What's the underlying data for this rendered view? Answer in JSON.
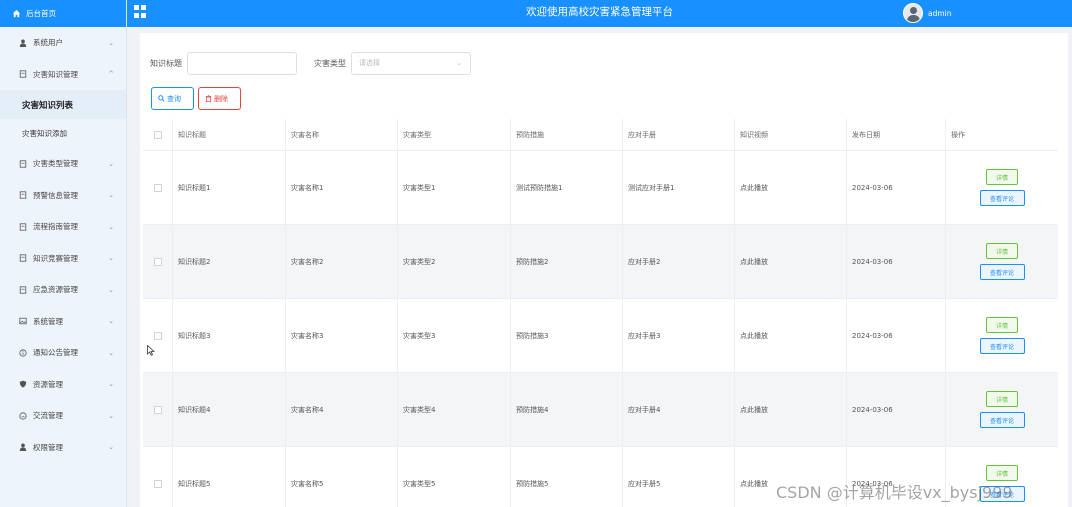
{
  "header": {
    "title": "欢迎使用高校灾害紧急管理平台",
    "user": "admin"
  },
  "sidebar": {
    "home": "后台首页",
    "items": [
      {
        "label": "系统用户",
        "icon": "user-icon",
        "expanded": false
      },
      {
        "label": "灾害知识管理",
        "icon": "doc-icon",
        "expanded": true,
        "children": [
          {
            "label": "灾害知识列表",
            "active": true
          },
          {
            "label": "灾害知识添加",
            "active": false
          }
        ]
      },
      {
        "label": "灾害类型管理",
        "icon": "doc-icon",
        "expanded": false
      },
      {
        "label": "预警信息管理",
        "icon": "doc-icon",
        "expanded": false
      },
      {
        "label": "流程指南管理",
        "icon": "doc-icon",
        "expanded": false
      },
      {
        "label": "知识竞赛管理",
        "icon": "doc-icon",
        "expanded": false
      },
      {
        "label": "应急资源管理",
        "icon": "doc-icon",
        "expanded": false
      },
      {
        "label": "系统管理",
        "icon": "image-icon",
        "expanded": false
      },
      {
        "label": "通知公告管理",
        "icon": "info-circle-icon",
        "expanded": false
      },
      {
        "label": "资源管理",
        "icon": "shield-icon",
        "expanded": false
      },
      {
        "label": "交流管理",
        "icon": "chat-icon",
        "expanded": false
      },
      {
        "label": "权限管理",
        "icon": "user-icon",
        "expanded": false
      }
    ]
  },
  "search": {
    "title_label": "知识标题",
    "title_value": "",
    "type_label": "灾害类型",
    "type_placeholder": "请选择"
  },
  "actions": {
    "query": "查询",
    "delete": "删除"
  },
  "table": {
    "columns": [
      "知识标题",
      "灾害名称",
      "灾害类型",
      "预防措施",
      "应对手册",
      "知识视频",
      "发布日期",
      "操作"
    ],
    "rows": [
      {
        "title": "知识标题1",
        "name": "灾害名称1",
        "type": "灾害类型1",
        "prevent": "测试预防措施1",
        "manual": "测试应对手册1",
        "video": "点此播放",
        "date": "2024-03-06"
      },
      {
        "title": "知识标题2",
        "name": "灾害名称2",
        "type": "灾害类型2",
        "prevent": "预防措施2",
        "manual": "应对手册2",
        "video": "点此播放",
        "date": "2024-03-06"
      },
      {
        "title": "知识标题3",
        "name": "灾害名称3",
        "type": "灾害类型3",
        "prevent": "预防措施3",
        "manual": "应对手册3",
        "video": "点此播放",
        "date": "2024-03-06"
      },
      {
        "title": "知识标题4",
        "name": "灾害名称4",
        "type": "灾害类型4",
        "prevent": "预防措施4",
        "manual": "应对手册4",
        "video": "点此播放",
        "date": "2024-03-06"
      },
      {
        "title": "知识标题5",
        "name": "灾害名称5",
        "type": "灾害类型5",
        "prevent": "预防措施5",
        "manual": "应对手册5",
        "video": "点此播放",
        "date": "2024-03-06"
      }
    ],
    "op_detail": "详情",
    "op_review": "查看评论"
  },
  "watermark": "CSDN @计算机毕设vx_bysj999",
  "colors": {
    "primary": "#1890ff",
    "danger": "#e64340",
    "success": "#67c23a",
    "sidebar_bg": "#eef4fb"
  }
}
